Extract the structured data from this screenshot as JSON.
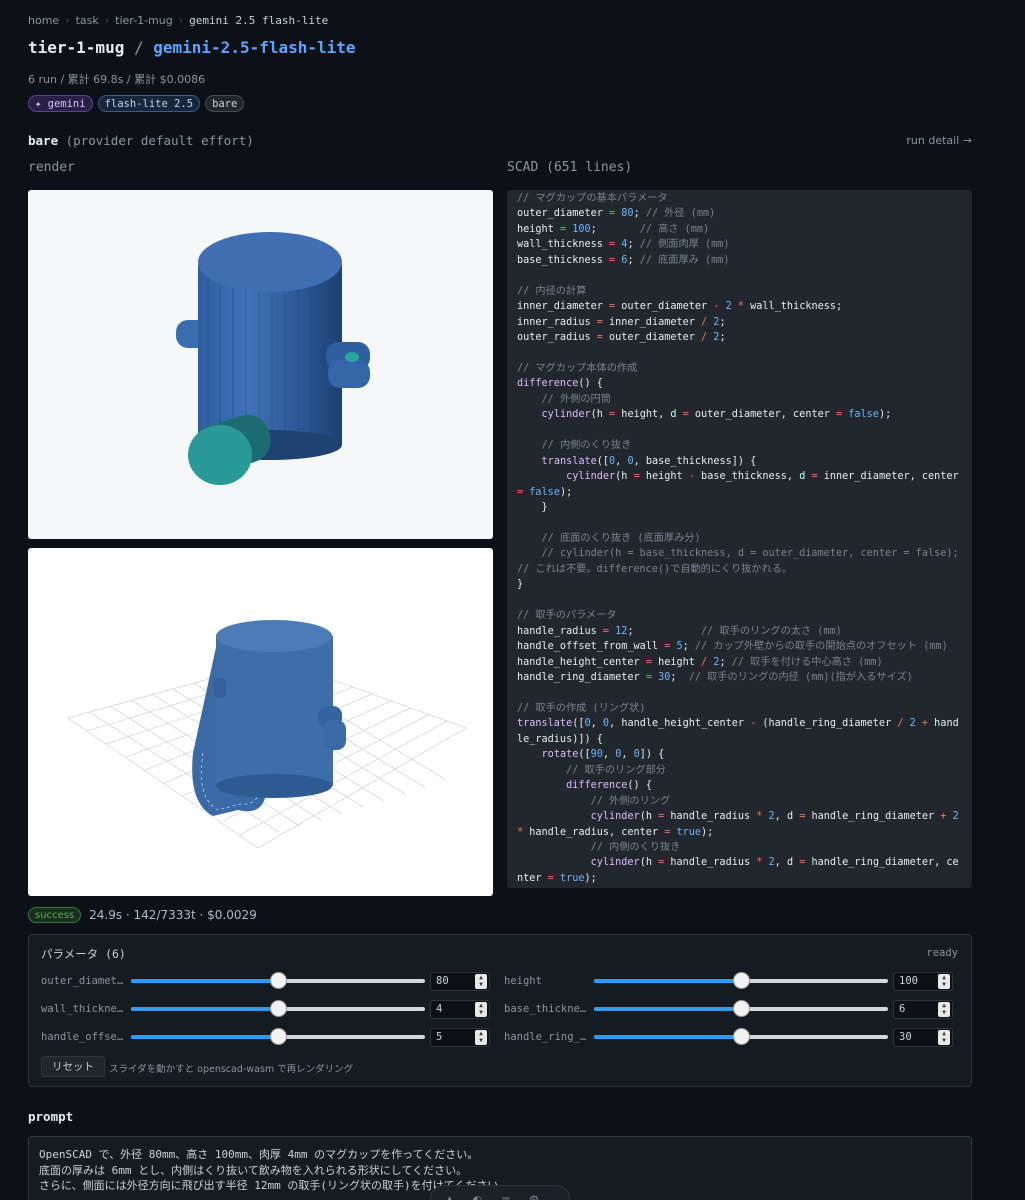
{
  "breadcrumb": [
    "home",
    "task",
    "tier-1-mug",
    "gemini 2.5 flash-lite"
  ],
  "header": {
    "task": "tier-1-mug",
    "sep": "/",
    "model": "gemini-2.5-flash-lite",
    "meta": "6 run / 累計 69.8s / 累計 $0.0086"
  },
  "tags": [
    "✦ gemini",
    "flash-lite 2.5",
    "bare"
  ],
  "section": {
    "name": "bare",
    "effort": "(provider default effort)",
    "run_detail": "run detail →"
  },
  "render_label": "render",
  "scad_label": "SCAD (651 lines)",
  "scad_lines": [
    [
      [
        "c",
        "// マグカップの基本パラメータ"
      ]
    ],
    [
      [
        "t",
        "outer_diameter "
      ],
      [
        "o",
        "="
      ],
      [
        "t",
        " "
      ],
      [
        "n",
        "80"
      ],
      [
        "t",
        "; "
      ],
      [
        "c",
        "// 外径 (mm)"
      ]
    ],
    [
      [
        "t",
        "height "
      ],
      [
        "o",
        "="
      ],
      [
        "t",
        " "
      ],
      [
        "n",
        "100"
      ],
      [
        "t",
        ";       "
      ],
      [
        "c",
        "// 高さ (mm)"
      ]
    ],
    [
      [
        "t",
        "wall_thickness "
      ],
      [
        "o",
        "="
      ],
      [
        "t",
        " "
      ],
      [
        "n",
        "4"
      ],
      [
        "t",
        "; "
      ],
      [
        "c",
        "// 側面肉厚 (mm)"
      ]
    ],
    [
      [
        "t",
        "base_thickness "
      ],
      [
        "o",
        "="
      ],
      [
        "t",
        " "
      ],
      [
        "n",
        "6"
      ],
      [
        "t",
        "; "
      ],
      [
        "c",
        "// 底面厚み (mm)"
      ]
    ],
    [
      [
        "t",
        ""
      ]
    ],
    [
      [
        "c",
        "// 内径の計算"
      ]
    ],
    [
      [
        "t",
        "inner_diameter "
      ],
      [
        "o",
        "="
      ],
      [
        "t",
        " outer_diameter "
      ],
      [
        "o",
        "-"
      ],
      [
        "t",
        " "
      ],
      [
        "n",
        "2"
      ],
      [
        "t",
        " "
      ],
      [
        "o",
        "*"
      ],
      [
        "t",
        " wall_thickness;"
      ]
    ],
    [
      [
        "t",
        "inner_radius "
      ],
      [
        "o",
        "="
      ],
      [
        "t",
        " inner_diameter "
      ],
      [
        "o",
        "/"
      ],
      [
        "t",
        " "
      ],
      [
        "n",
        "2"
      ],
      [
        "t",
        ";"
      ]
    ],
    [
      [
        "t",
        "outer_radius "
      ],
      [
        "o",
        "="
      ],
      [
        "t",
        " outer_diameter "
      ],
      [
        "o",
        "/"
      ],
      [
        "t",
        " "
      ],
      [
        "n",
        "2"
      ],
      [
        "t",
        ";"
      ]
    ],
    [
      [
        "t",
        ""
      ]
    ],
    [
      [
        "c",
        "// マグカップ本体の作成"
      ]
    ],
    [
      [
        "k",
        "difference"
      ],
      [
        "t",
        "() {"
      ]
    ],
    [
      [
        "t",
        "    "
      ],
      [
        "c",
        "// 外側の円筒"
      ]
    ],
    [
      [
        "t",
        "    "
      ],
      [
        "k",
        "cylinder"
      ],
      [
        "t",
        "(h "
      ],
      [
        "o",
        "="
      ],
      [
        "t",
        " height, d "
      ],
      [
        "o",
        "="
      ],
      [
        "t",
        " outer_diameter, center "
      ],
      [
        "o",
        "="
      ],
      [
        "t",
        " "
      ],
      [
        "n",
        "false"
      ],
      [
        "t",
        ");"
      ]
    ],
    [
      [
        "t",
        ""
      ]
    ],
    [
      [
        "t",
        "    "
      ],
      [
        "c",
        "// 内側のくり抜き"
      ]
    ],
    [
      [
        "t",
        "    "
      ],
      [
        "k",
        "translate"
      ],
      [
        "t",
        "(["
      ],
      [
        "n",
        "0"
      ],
      [
        "t",
        ", "
      ],
      [
        "n",
        "0"
      ],
      [
        "t",
        ", base_thickness]) {"
      ]
    ],
    [
      [
        "t",
        "        "
      ],
      [
        "k",
        "cylinder"
      ],
      [
        "t",
        "(h "
      ],
      [
        "o",
        "="
      ],
      [
        "t",
        " height "
      ],
      [
        "o",
        "-"
      ],
      [
        "t",
        " base_thickness, d "
      ],
      [
        "o",
        "="
      ],
      [
        "t",
        " inner_diameter, center "
      ],
      [
        "o",
        "="
      ],
      [
        "t",
        " "
      ],
      [
        "n",
        "false"
      ],
      [
        "t",
        ");"
      ]
    ],
    [
      [
        "t",
        "    }"
      ]
    ],
    [
      [
        "t",
        ""
      ]
    ],
    [
      [
        "t",
        "    "
      ],
      [
        "c",
        "// 底面のくり抜き (底面厚み分)"
      ]
    ],
    [
      [
        "t",
        "    "
      ],
      [
        "c",
        "// cylinder(h = base_thickness, d = outer_diameter, center = false); // これは不要。difference()で自動的にくり抜かれる。"
      ]
    ],
    [
      [
        "t",
        "}"
      ]
    ],
    [
      [
        "t",
        ""
      ]
    ],
    [
      [
        "c",
        "// 取手のパラメータ"
      ]
    ],
    [
      [
        "t",
        "handle_radius "
      ],
      [
        "o",
        "="
      ],
      [
        "t",
        " "
      ],
      [
        "n",
        "12"
      ],
      [
        "t",
        ";           "
      ],
      [
        "c",
        "// 取手のリングの太さ (mm)"
      ]
    ],
    [
      [
        "t",
        "handle_offset_from_wall "
      ],
      [
        "o",
        "="
      ],
      [
        "t",
        " "
      ],
      [
        "n",
        "5"
      ],
      [
        "t",
        "; "
      ],
      [
        "c",
        "// カップ外壁からの取手の開始点のオフセット (mm)"
      ]
    ],
    [
      [
        "t",
        "handle_height_center "
      ],
      [
        "o",
        "="
      ],
      [
        "t",
        " height "
      ],
      [
        "o",
        "/"
      ],
      [
        "t",
        " "
      ],
      [
        "n",
        "2"
      ],
      [
        "t",
        "; "
      ],
      [
        "c",
        "// 取手を付ける中心高さ (mm)"
      ]
    ],
    [
      [
        "t",
        "handle_ring_diameter "
      ],
      [
        "o",
        "="
      ],
      [
        "t",
        " "
      ],
      [
        "n",
        "30"
      ],
      [
        "t",
        ";  "
      ],
      [
        "c",
        "// 取手のリングの内径 (mm)(指が入るサイズ)"
      ]
    ],
    [
      [
        "t",
        ""
      ]
    ],
    [
      [
        "c",
        "// 取手の作成 (リング状)"
      ]
    ],
    [
      [
        "k",
        "translate"
      ],
      [
        "t",
        "(["
      ],
      [
        "n",
        "0"
      ],
      [
        "t",
        ", "
      ],
      [
        "n",
        "0"
      ],
      [
        "t",
        ", handle_height_center "
      ],
      [
        "o",
        "-"
      ],
      [
        "t",
        " (handle_ring_diameter "
      ],
      [
        "o",
        "/"
      ],
      [
        "t",
        " "
      ],
      [
        "n",
        "2"
      ],
      [
        "t",
        " "
      ],
      [
        "o",
        "+"
      ],
      [
        "t",
        " handle_radius)]) {"
      ]
    ],
    [
      [
        "t",
        "    "
      ],
      [
        "k",
        "rotate"
      ],
      [
        "t",
        "(["
      ],
      [
        "n",
        "90"
      ],
      [
        "t",
        ", "
      ],
      [
        "n",
        "0"
      ],
      [
        "t",
        ", "
      ],
      [
        "n",
        "0"
      ],
      [
        "t",
        "]) {"
      ]
    ],
    [
      [
        "t",
        "        "
      ],
      [
        "c",
        "// 取手のリング部分"
      ]
    ],
    [
      [
        "t",
        "        "
      ],
      [
        "k",
        "difference"
      ],
      [
        "t",
        "() {"
      ]
    ],
    [
      [
        "t",
        "            "
      ],
      [
        "c",
        "// 外側のリング"
      ]
    ],
    [
      [
        "t",
        "            "
      ],
      [
        "k",
        "cylinder"
      ],
      [
        "t",
        "(h "
      ],
      [
        "o",
        "="
      ],
      [
        "t",
        " handle_radius "
      ],
      [
        "o",
        "*"
      ],
      [
        "t",
        " "
      ],
      [
        "n",
        "2"
      ],
      [
        "t",
        ", d "
      ],
      [
        "o",
        "="
      ],
      [
        "t",
        " handle_ring_diameter "
      ],
      [
        "o",
        "+"
      ],
      [
        "t",
        " "
      ],
      [
        "n",
        "2"
      ],
      [
        "t",
        " "
      ],
      [
        "o",
        "*"
      ],
      [
        "t",
        " handle_radius, center "
      ],
      [
        "o",
        "="
      ],
      [
        "t",
        " "
      ],
      [
        "n",
        "true"
      ],
      [
        "t",
        ");"
      ]
    ],
    [
      [
        "t",
        "            "
      ],
      [
        "c",
        "// 内側のくり抜き"
      ]
    ],
    [
      [
        "t",
        "            "
      ],
      [
        "k",
        "cylinder"
      ],
      [
        "t",
        "(h "
      ],
      [
        "o",
        "="
      ],
      [
        "t",
        " handle_radius "
      ],
      [
        "o",
        "*"
      ],
      [
        "t",
        " "
      ],
      [
        "n",
        "2"
      ],
      [
        "t",
        ", d "
      ],
      [
        "o",
        "="
      ],
      [
        "t",
        " handle_ring_diameter, center "
      ],
      [
        "o",
        "="
      ],
      [
        "t",
        " "
      ],
      [
        "n",
        "true"
      ],
      [
        "t",
        ");"
      ]
    ]
  ],
  "run": {
    "status": "success",
    "stats": "24.9s · 142/7333t · $0.0029"
  },
  "params": {
    "title": "パラメータ (6)",
    "state": "ready",
    "items": [
      {
        "name": "outer_diamet…",
        "value": "80",
        "level": 0.5
      },
      {
        "name": "height",
        "value": "100",
        "level": 0.5
      },
      {
        "name": "wall_thickne…",
        "value": "4",
        "level": 0.5
      },
      {
        "name": "base_thickne…",
        "value": "6",
        "level": 0.5
      },
      {
        "name": "handle_offse…",
        "value": "5",
        "level": 0.5
      },
      {
        "name": "handle_ring_…",
        "value": "30",
        "level": 0.5
      }
    ],
    "reset": "リセット",
    "hint": "スライダを動かすと openscad-wasm で再レンダリング"
  },
  "prompt": {
    "label": "prompt",
    "lines": [
      "OpenSCAD で、外径 80mm、高さ 100mm、肉厚 4mm のマグカップを作ってください。",
      "底面の厚みは 6mm とし、内側はくり抜いて飲み物を入れられる形状にしてください。",
      "さらに、側面には外径方向に飛び出す半径 12mm の取手(リング状の取手)を付けてください。"
    ]
  },
  "colors": {
    "accent": "#58a6ff",
    "success": "#57ab5a",
    "slider": "#2f9cf0"
  }
}
